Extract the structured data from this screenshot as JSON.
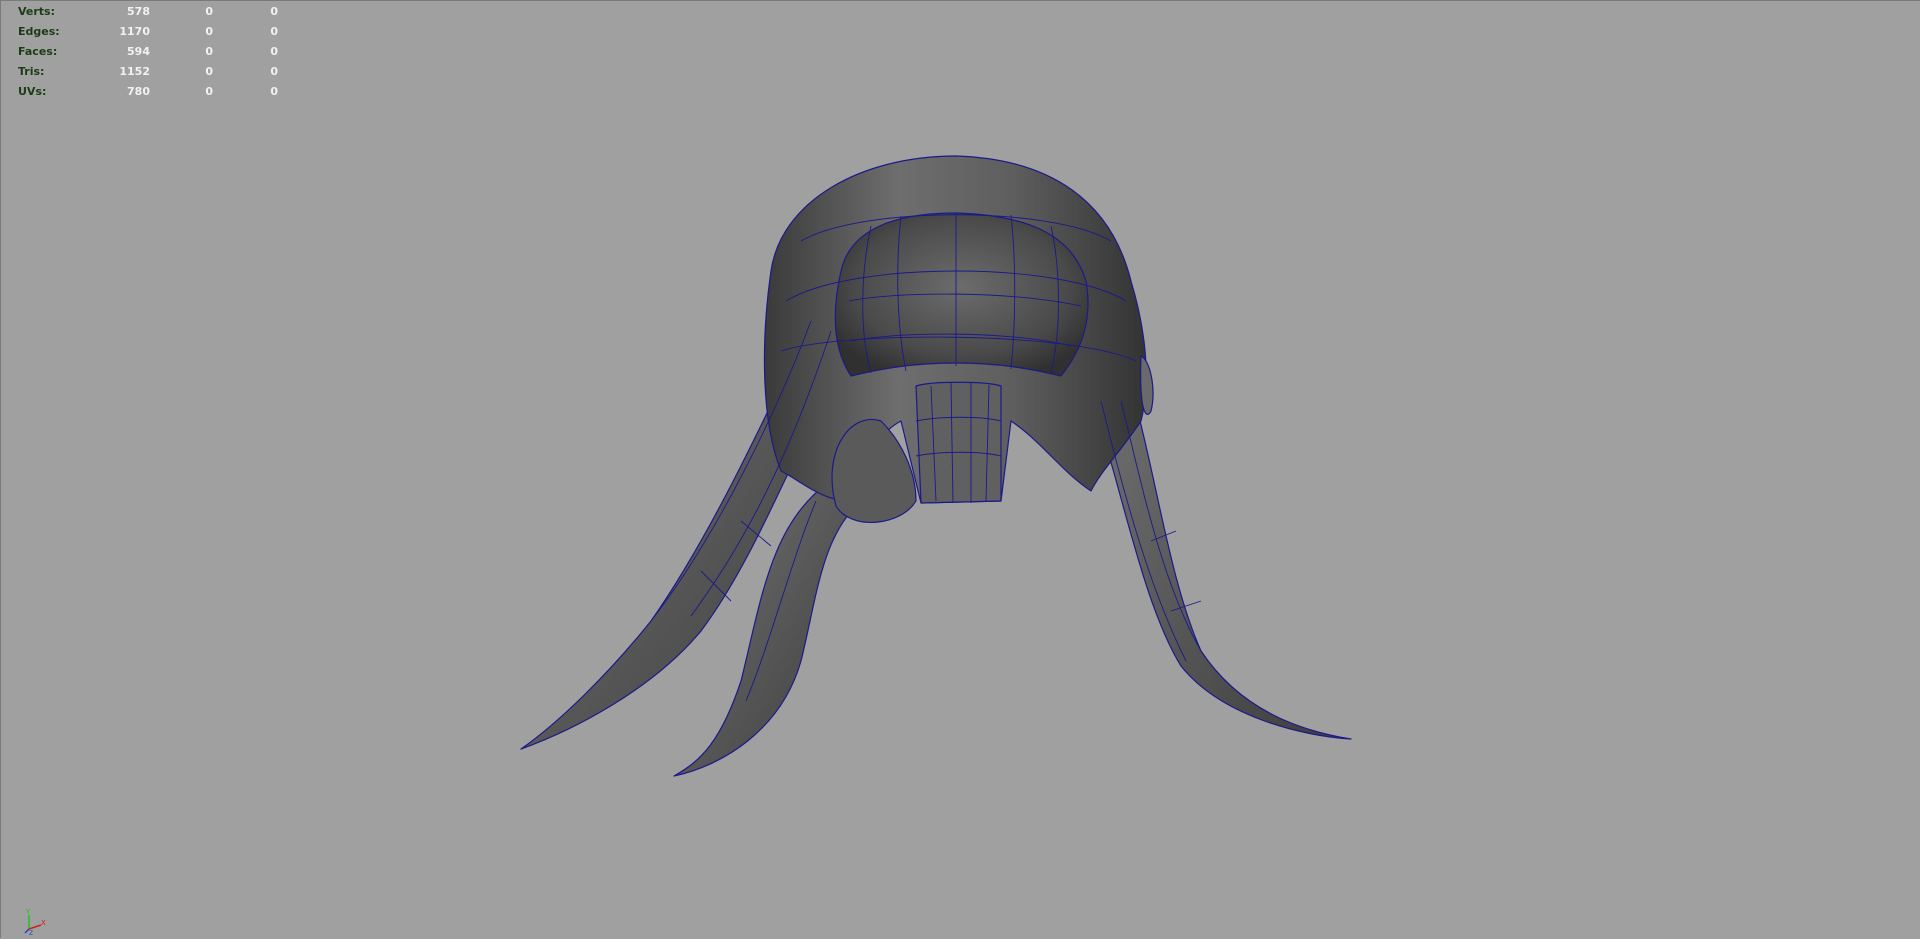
{
  "hud": {
    "rows": [
      {
        "label": "Verts:",
        "v1": "578",
        "v2": "0",
        "v3": "0"
      },
      {
        "label": "Edges:",
        "v1": "1170",
        "v2": "0",
        "v3": "0"
      },
      {
        "label": "Faces:",
        "v1": "594",
        "v2": "0",
        "v3": "0"
      },
      {
        "label": "Tris:",
        "v1": "1152",
        "v2": "0",
        "v3": "0"
      },
      {
        "label": "UVs:",
        "v1": "780",
        "v2": "0",
        "v3": "0"
      }
    ]
  },
  "colors": {
    "background": "#a0a0a0",
    "wireframe": "#1a1a8a",
    "hud_label": "#1a3d14",
    "hud_value": "#f2f2f2",
    "mesh_shade": "#5a5a5a"
  },
  "axis_gizmo": {
    "y_label": "Y",
    "x_label": "X",
    "z_label": "Z"
  }
}
